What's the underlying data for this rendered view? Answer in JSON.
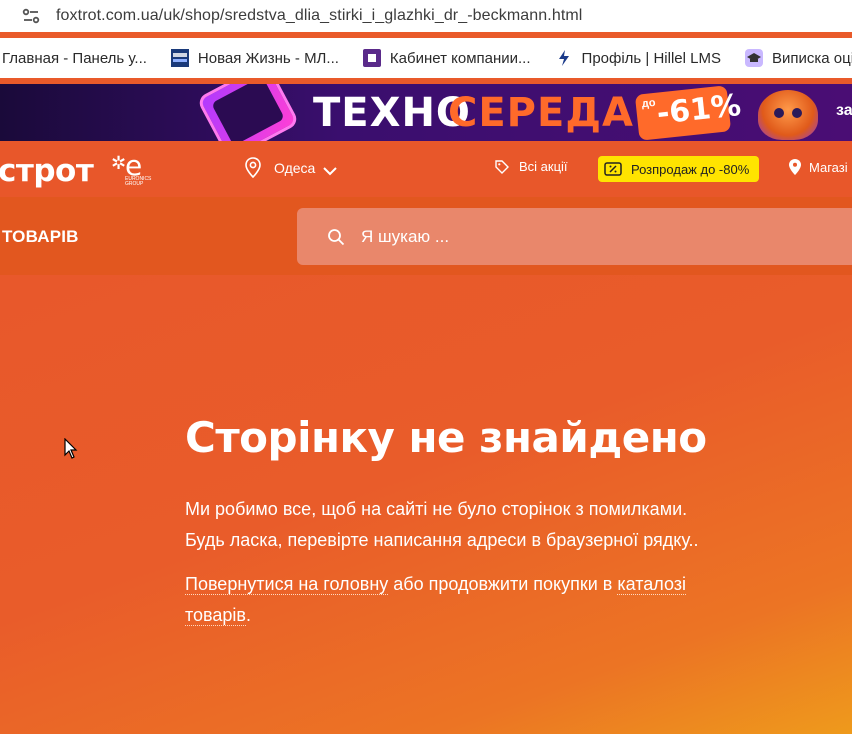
{
  "browser": {
    "url": "foxtrot.com.ua/uk/shop/sredstva_dlia_stirki_i_glazhki_dr_-beckmann.html",
    "bookmarks": [
      {
        "label": "Главная - Панель у...",
        "icon": "home-favicon",
        "color": "#ffffff"
      },
      {
        "label": "Новая Жизнь - МЛ...",
        "icon": "newlife-favicon",
        "color": "#1a3a7a"
      },
      {
        "label": "Кабинет компании...",
        "icon": "square-favicon",
        "color": "#5a2a8a"
      },
      {
        "label": "Профіль | Hillel LMS",
        "icon": "hillel-favicon",
        "color": "#1a3a8a"
      },
      {
        "label": "Виписка оцін",
        "icon": "cap-favicon",
        "color": "#333333"
      }
    ]
  },
  "promo": {
    "title_white": "ТЕХНО",
    "title_orange": "СЕРЕДА",
    "badge_prefix": "до",
    "badge_value": "-61%",
    "tail": "за"
  },
  "header": {
    "logo": "строт",
    "group_top": "EURONICS",
    "group_bottom": "GROUP",
    "city": "Одеса",
    "all_promos": "Всі акції",
    "sale_button": "Розпродаж до -80%",
    "shops": "Магазі"
  },
  "subheader": {
    "catalog_label": "ТОВАРІВ",
    "search_placeholder": "Я шукаю ..."
  },
  "main": {
    "title": "Сторінку не знайдено",
    "line1": "Ми робимо все, щоб на сайті не було сторінок з помилками.",
    "line2": "Будь ласка, перевірте написання адреси в браузерної рядку..",
    "link_home": "Повернутися на головну",
    "mid_text": " або продовжити покупки в ",
    "link_catalog_1": "каталозі",
    "link_catalog_2": "товарів",
    "end_dot": "."
  },
  "colors": {
    "brand_orange": "#e8572a",
    "sale_yellow": "#ffe400"
  }
}
